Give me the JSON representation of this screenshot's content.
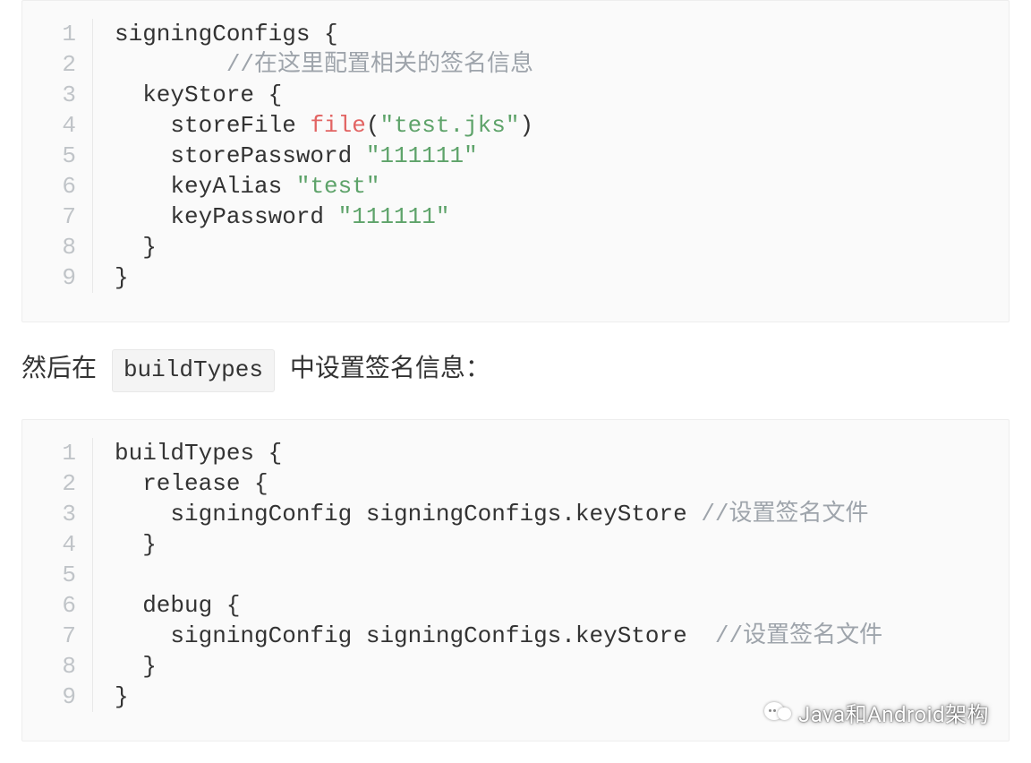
{
  "codeblock1": {
    "lines": [
      {
        "n": "1",
        "segments": [
          {
            "cls": "tok-plain",
            "text": "signingConfigs {"
          }
        ]
      },
      {
        "n": "2",
        "segments": [
          {
            "cls": "tok-plain",
            "text": "        "
          },
          {
            "cls": "tok-comment",
            "text": "//在这里配置相关的签名信息"
          }
        ]
      },
      {
        "n": "3",
        "segments": [
          {
            "cls": "tok-plain",
            "text": "  keyStore {"
          }
        ]
      },
      {
        "n": "4",
        "segments": [
          {
            "cls": "tok-plain",
            "text": "    storeFile "
          },
          {
            "cls": "tok-func",
            "text": "file"
          },
          {
            "cls": "tok-plain",
            "text": "("
          },
          {
            "cls": "tok-string",
            "text": "\"test.jks\""
          },
          {
            "cls": "tok-plain",
            "text": ")"
          }
        ]
      },
      {
        "n": "5",
        "segments": [
          {
            "cls": "tok-plain",
            "text": "    storePassword "
          },
          {
            "cls": "tok-string",
            "text": "\"111111\""
          }
        ]
      },
      {
        "n": "6",
        "segments": [
          {
            "cls": "tok-plain",
            "text": "    keyAlias "
          },
          {
            "cls": "tok-string",
            "text": "\"test\""
          }
        ]
      },
      {
        "n": "7",
        "segments": [
          {
            "cls": "tok-plain",
            "text": "    keyPassword "
          },
          {
            "cls": "tok-string",
            "text": "\"111111\""
          }
        ]
      },
      {
        "n": "8",
        "segments": [
          {
            "cls": "tok-plain",
            "text": "  }"
          }
        ]
      },
      {
        "n": "9",
        "segments": [
          {
            "cls": "tok-plain",
            "text": "}"
          }
        ]
      }
    ]
  },
  "prose": {
    "before": "然后在 ",
    "inline": "buildTypes",
    "after": " 中设置签名信息："
  },
  "codeblock2": {
    "lines": [
      {
        "n": "1",
        "segments": [
          {
            "cls": "tok-plain",
            "text": "buildTypes {"
          }
        ]
      },
      {
        "n": "2",
        "segments": [
          {
            "cls": "tok-plain",
            "text": "  release {"
          }
        ]
      },
      {
        "n": "3",
        "segments": [
          {
            "cls": "tok-plain",
            "text": "    signingConfig signingConfigs.keyStore "
          },
          {
            "cls": "tok-comment",
            "text": "//设置签名文件"
          }
        ]
      },
      {
        "n": "4",
        "segments": [
          {
            "cls": "tok-plain",
            "text": "  }"
          }
        ]
      },
      {
        "n": "5",
        "segments": [
          {
            "cls": "tok-plain",
            "text": ""
          }
        ]
      },
      {
        "n": "6",
        "segments": [
          {
            "cls": "tok-plain",
            "text": "  debug {"
          }
        ]
      },
      {
        "n": "7",
        "segments": [
          {
            "cls": "tok-plain",
            "text": "    signingConfig signingConfigs.keyStore  "
          },
          {
            "cls": "tok-comment",
            "text": "//设置签名文件"
          }
        ]
      },
      {
        "n": "8",
        "segments": [
          {
            "cls": "tok-plain",
            "text": "  }"
          }
        ]
      },
      {
        "n": "9",
        "segments": [
          {
            "cls": "tok-plain",
            "text": "}"
          }
        ]
      }
    ]
  },
  "watermark": {
    "text": "Java和Android架构"
  }
}
